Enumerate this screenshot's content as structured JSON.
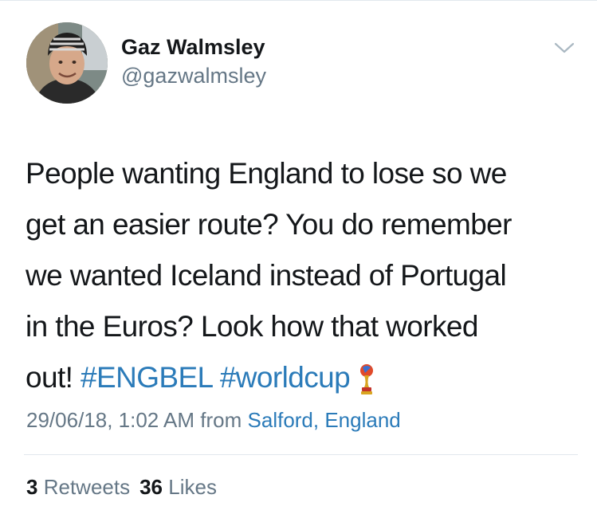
{
  "tweet": {
    "author": {
      "display_name": "Gaz Walmsley",
      "handle": "@gazwalmsley",
      "avatar": "profile-photo"
    },
    "menu_icon": "chevron-down-icon",
    "text_lines": [
      "People wanting England to lose so we",
      "get an easier route? You do remember",
      "we wanted Iceland instead of Portugal",
      "in the Euros? Look how that worked",
      "out!"
    ],
    "hashtags": [
      "#ENGBEL",
      "#worldcup"
    ],
    "emoji": "world-cup-trophy-icon",
    "timestamp": "29/06/18, 1:02 AM",
    "from_label": "from",
    "location": "Salford, England",
    "retweets": {
      "count": "3",
      "label": "Retweets"
    },
    "likes": {
      "count": "36",
      "label": "Likes"
    }
  },
  "colors": {
    "text": "#14171a",
    "secondary": "#657786",
    "link": "#2b7bb9",
    "divider": "#e1e8ed"
  }
}
